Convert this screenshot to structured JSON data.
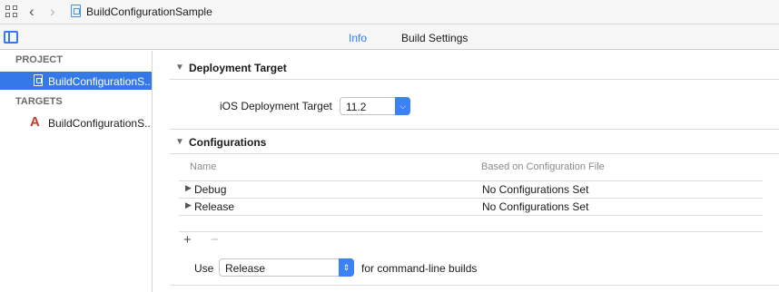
{
  "toolbar": {
    "breadcrumb": "BuildConfigurationSample",
    "back_symbol": "‹",
    "forward_symbol": "›"
  },
  "tabs": [
    {
      "label": "Info",
      "active": true
    },
    {
      "label": "Build Settings",
      "active": false
    }
  ],
  "sidebar": {
    "project_header": "PROJECT",
    "project_item": "BuildConfigurationS...",
    "targets_header": "TARGETS",
    "target_item": "BuildConfigurationS..."
  },
  "deployment": {
    "title": "Deployment Target",
    "field_label": "iOS Deployment Target",
    "value": "11.2"
  },
  "configurations": {
    "title": "Configurations",
    "columns": [
      "Name",
      "Based on Configuration File"
    ],
    "rows": [
      {
        "name": "Debug",
        "value": "No Configurations Set"
      },
      {
        "name": "Release",
        "value": "No Configurations Set"
      }
    ],
    "add_symbol": "+",
    "remove_symbol": "−",
    "use_label": "Use",
    "use_value": "Release",
    "use_suffix": "for command-line builds"
  },
  "colors": {
    "accent": "#3478f6",
    "selection": "#3479e8",
    "app_icon": "#c73c2c"
  },
  "icons": {
    "grid": "grid-icon",
    "back": "chevron-left-icon",
    "forward": "chevron-right-icon",
    "file": "project-file-icon",
    "sidebar": "sidebar-toggle-icon",
    "target": "app-target-icon"
  }
}
